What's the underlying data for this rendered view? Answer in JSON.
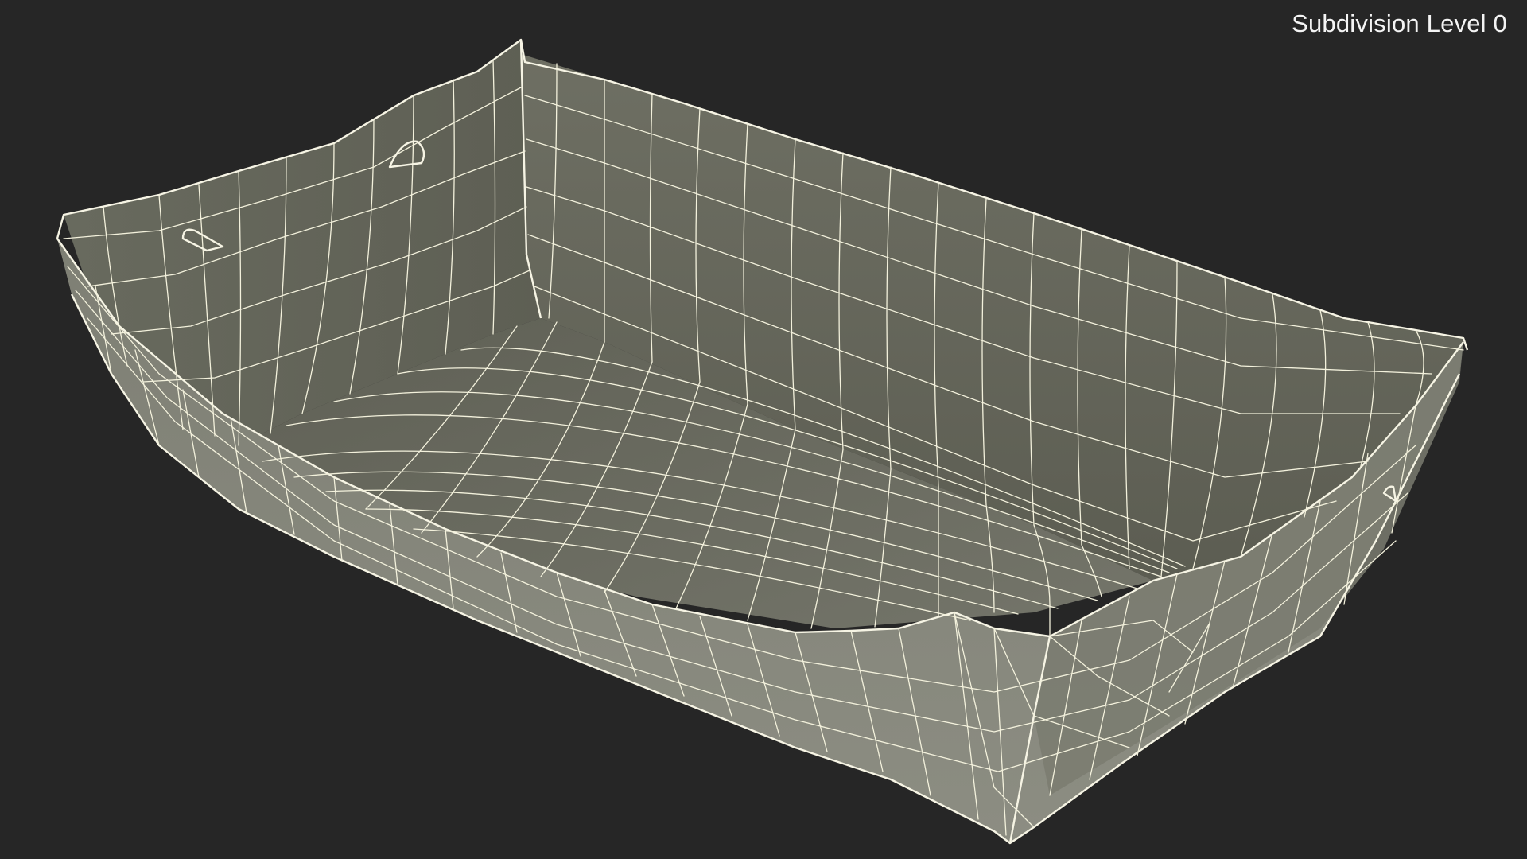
{
  "viewport": {
    "subdivision_label": "Subdivision Level 0",
    "background_color": "#262626"
  },
  "model": {
    "description_icon": "wireframe-tray-model",
    "surface_inner_far_color": "#66675b",
    "surface_inner_floor_color": "#6c6d61",
    "surface_outer_front_color": "#84857a",
    "wire_color": "#f3f1dc"
  }
}
